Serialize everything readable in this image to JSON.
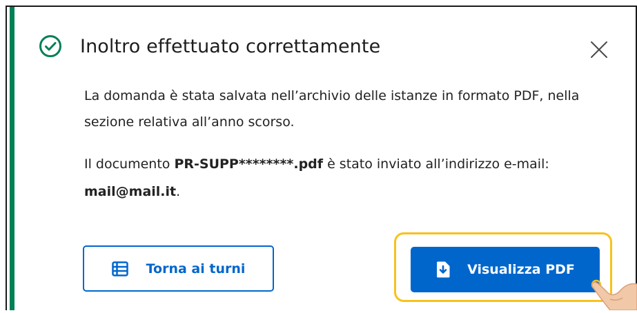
{
  "dialog": {
    "title": "Inoltro effettuato correttamente",
    "paragraph1": "La domanda è stata salvata nell’archivio delle istanze in formato PDF, nella sezione relativa all’anno scorso.",
    "paragraph2": {
      "prefix": "Il documento ",
      "filename": "PR-SUPP********.pdf",
      "middle": " è stato inviato all’indirizzo e-mail: ",
      "email": "mail@mail.it",
      "suffix": "."
    }
  },
  "buttons": {
    "back_label": "Torna ai turni",
    "view_pdf_label": "Visualizza PDF"
  },
  "icons": {
    "success": "check-circle-icon",
    "close": "close-icon",
    "list": "list-icon",
    "document_download": "document-download-icon",
    "pointer": "hand-pointer-icon"
  },
  "colors": {
    "success_green": "#008055",
    "primary_blue": "#0066cc",
    "highlight_yellow": "#f7c21a",
    "text_dark": "#1a1a1a"
  }
}
